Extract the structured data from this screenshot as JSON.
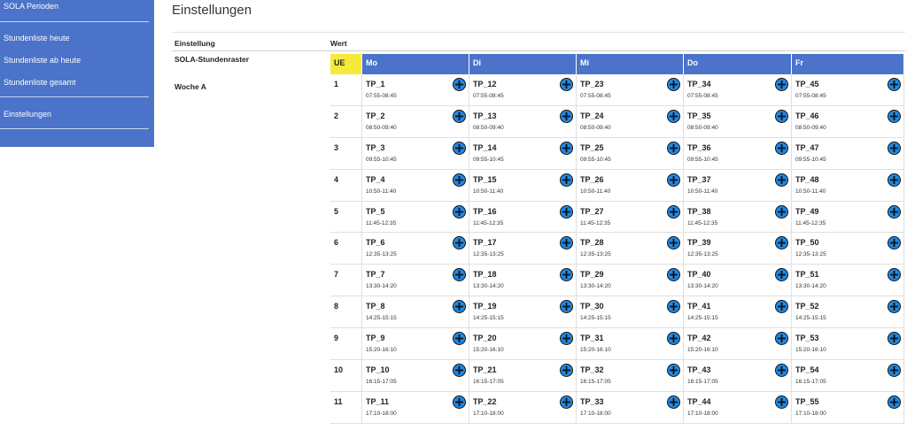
{
  "sidebar": {
    "items": [
      {
        "label": "SOLA Perioden"
      },
      {
        "label": "Stundenliste heute"
      },
      {
        "label": "Stundenliste ab heute"
      },
      {
        "label": "Stundenliste gesamt"
      },
      {
        "label": "Einstellungen"
      }
    ]
  },
  "page": {
    "title": "Einstellungen",
    "col_setting": "Einstellung",
    "col_value": "Wert",
    "setting_name": "SOLA-Stundenraster",
    "week_label": "Woche A"
  },
  "timetable": {
    "ue_header": "UE",
    "days": [
      "Mo",
      "Di",
      "Mi",
      "Do",
      "Fr"
    ],
    "rows": [
      {
        "ue": "1",
        "time": "07:55-08:45",
        "cells": [
          "TP_1",
          "TP_12",
          "TP_23",
          "TP_34",
          "TP_45"
        ]
      },
      {
        "ue": "2",
        "time": "08:50-09:40",
        "cells": [
          "TP_2",
          "TP_13",
          "TP_24",
          "TP_35",
          "TP_46"
        ]
      },
      {
        "ue": "3",
        "time": "09:55-10:45",
        "cells": [
          "TP_3",
          "TP_14",
          "TP_25",
          "TP_36",
          "TP_47"
        ]
      },
      {
        "ue": "4",
        "time": "10:50-11:40",
        "cells": [
          "TP_4",
          "TP_15",
          "TP_26",
          "TP_37",
          "TP_48"
        ]
      },
      {
        "ue": "5",
        "time": "11:45-12:35",
        "cells": [
          "TP_5",
          "TP_16",
          "TP_27",
          "TP_38",
          "TP_49"
        ]
      },
      {
        "ue": "6",
        "time": "12:35-13:25",
        "cells": [
          "TP_6",
          "TP_17",
          "TP_28",
          "TP_39",
          "TP_50"
        ]
      },
      {
        "ue": "7",
        "time": "13:30-14:20",
        "cells": [
          "TP_7",
          "TP_18",
          "TP_29",
          "TP_40",
          "TP_51"
        ]
      },
      {
        "ue": "8",
        "time": "14:25-15:15",
        "cells": [
          "TP_8",
          "TP_19",
          "TP_30",
          "TP_41",
          "TP_52"
        ]
      },
      {
        "ue": "9",
        "time": "15:20-16:10",
        "cells": [
          "TP_9",
          "TP_20",
          "TP_31",
          "TP_42",
          "TP_53"
        ]
      },
      {
        "ue": "10",
        "time": "16:15-17:05",
        "cells": [
          "TP_10",
          "TP_21",
          "TP_32",
          "TP_43",
          "TP_54"
        ]
      },
      {
        "ue": "11",
        "time": "17:10-18:00",
        "cells": [
          "TP_11",
          "TP_22",
          "TP_33",
          "TP_44",
          "TP_55"
        ]
      }
    ]
  },
  "colors": {
    "accent": "#4a73c9",
    "ue_highlight": "#f7e93b",
    "add_button": "#1e88e5"
  },
  "icons": {
    "add": "plus-circle-icon"
  }
}
